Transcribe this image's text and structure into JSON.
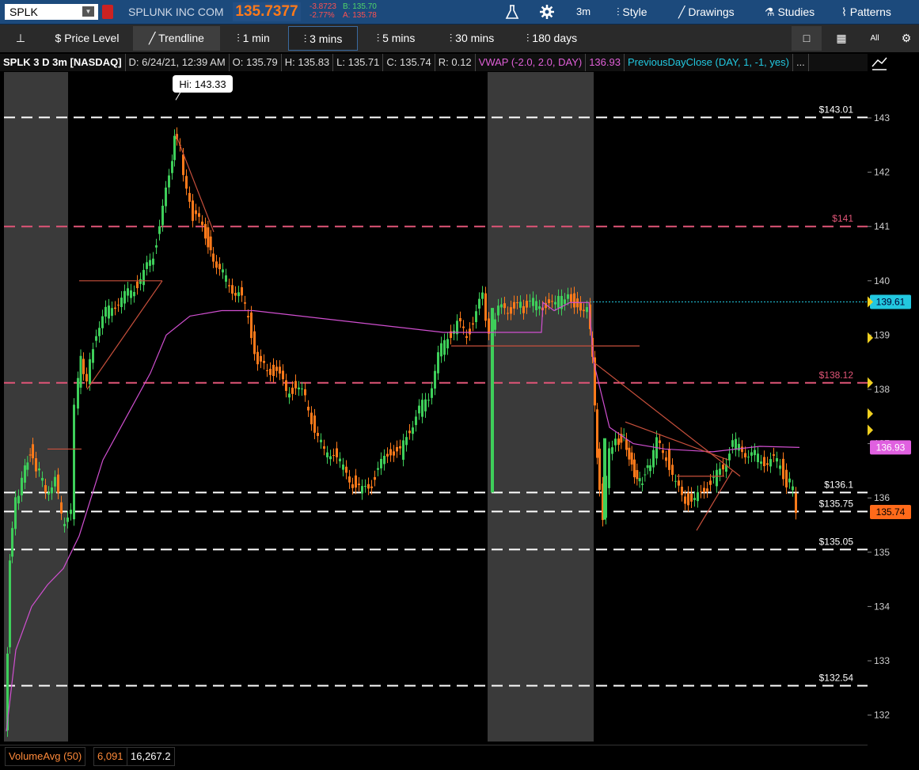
{
  "header": {
    "symbol": "SPLK",
    "company": "SPLUNK INC COM",
    "last": "135.7377",
    "change": "-3.8723",
    "change_pct": "-2.77%",
    "bid": "B: 135.70",
    "ask": "A: 135.78",
    "timeframe": "3m",
    "style": "Style",
    "drawings": "Drawings",
    "studies": "Studies",
    "patterns": "Patterns"
  },
  "toolbar": {
    "price_level": "Price Level",
    "trendline": "Trendline",
    "tf": [
      "1 min",
      "3 mins",
      "5 mins",
      "30 mins",
      "180 days"
    ],
    "all": "All"
  },
  "info": {
    "title": "SPLK 3 D 3m [NASDAQ]",
    "date": "D: 6/24/21, 12:39 AM",
    "open": "O: 135.79",
    "high": "H: 135.83",
    "low": "L: 135.71",
    "close": "C: 135.74",
    "range": "R: 0.12",
    "vwap": "VWAP (-2.0, 2.0, DAY)",
    "vwap_val": "136.93",
    "pdc": "PreviousDayClose (DAY, 1, -1, yes)",
    "more": "..."
  },
  "chart_data": {
    "type": "candlestick",
    "ylim": [
      131.5,
      144.2
    ],
    "y_ticks": [
      132,
      133,
      134,
      135,
      136,
      137,
      138,
      139,
      140,
      141,
      142,
      143
    ],
    "hi_label": "Hi: 143.33",
    "levels": [
      {
        "price": 143.01,
        "label": "$143.01",
        "color": "#ffffff"
      },
      {
        "price": 141,
        "label": "$141",
        "color": "#e05577"
      },
      {
        "price": 138.12,
        "label": "$138.12",
        "color": "#e05577"
      },
      {
        "price": 136.1,
        "label": "$136.1",
        "color": "#ffffff"
      },
      {
        "price": 135.75,
        "label": "$135.75",
        "color": "#ffffff"
      },
      {
        "price": 135.05,
        "label": "$135.05",
        "color": "#ffffff"
      },
      {
        "price": 132.54,
        "label": "$132.54",
        "color": "#ffffff"
      }
    ],
    "prev_close": 139.61,
    "prev_close_label": "139.61",
    "vwap_label": "136.93",
    "last_label": "135.74"
  },
  "volume": {
    "name": "VolumeAvg (50)",
    "v1": "6,091",
    "v2": "16,267.2"
  },
  "colors": {
    "up": "#3ecf5a",
    "down": "#ff7a1a",
    "vwap": "#d04fd0",
    "prev": "#22c8e0",
    "trend": "#c8503c"
  }
}
